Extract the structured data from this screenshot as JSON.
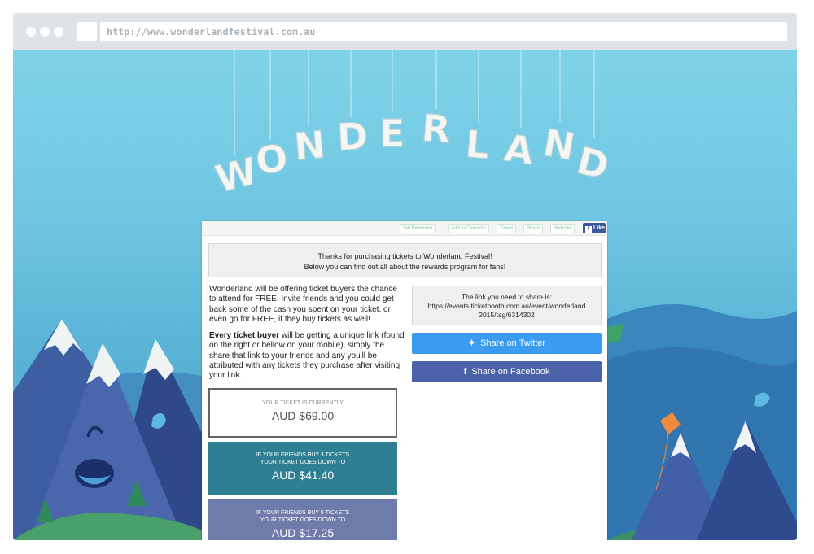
{
  "browser": {
    "url": "http://www.wonderlandfestival.com.au"
  },
  "toolbar": {
    "set_reminder": "Set Reminder",
    "add_to_calendar": "Add to Calendar",
    "tweet": "Tweet",
    "share": "Share",
    "website": "Website",
    "like": "Like"
  },
  "banner": {
    "letters": [
      "W",
      "O",
      "N",
      "D",
      "E",
      "R",
      "L",
      "A",
      "N",
      "D"
    ]
  },
  "thanks": {
    "line1": "Thanks for purchasing tickets to Wonderland Festival!",
    "line2": "Below you can find out all about the rewards program for fans!"
  },
  "info": {
    "paragraph1": "Wonderland will be offering ticket buyers the chance to attend for FREE. Invite friends and you could get back some of the cash you spent on your ticket, or even go for FREE, if they buy tickets as well!",
    "paragraph2_bold": "Every ticket buyer",
    "paragraph2_rest": " will be getting a unique link (found on the right or bellow on your mobile), simply the share that link to your friends and any you'll be attributed with any tickets they purchase after visiting your link."
  },
  "share_link": {
    "heading": "The link you need to share is:",
    "url_line1": "https://events.ticketbooth.com.au/event/wonderland",
    "url_line2": "2015/tag/6314302"
  },
  "buttons": {
    "twitter": "Share on Twitter",
    "facebook": "Share on Facebook"
  },
  "prices": [
    {
      "label1": "YOUR TICKET IS CURRENTLY",
      "label2": "",
      "amount": "AUD $69.00"
    },
    {
      "label1": "IF YOUR FRIENDS BUY 3 TICKETS",
      "label2": "YOUR TICKET GOES DOWN TO",
      "amount": "AUD $41.40"
    },
    {
      "label1": "IF YOUR FRIENDS BUY 5 TICKETS",
      "label2": "YOUR TICKET GOES DOWN TO",
      "amount": "AUD $17.25"
    }
  ],
  "colors": {
    "twitter": "#3b9bef",
    "facebook": "#4a63a8",
    "teal": "#2f7f94",
    "purple": "#6e7bab"
  }
}
